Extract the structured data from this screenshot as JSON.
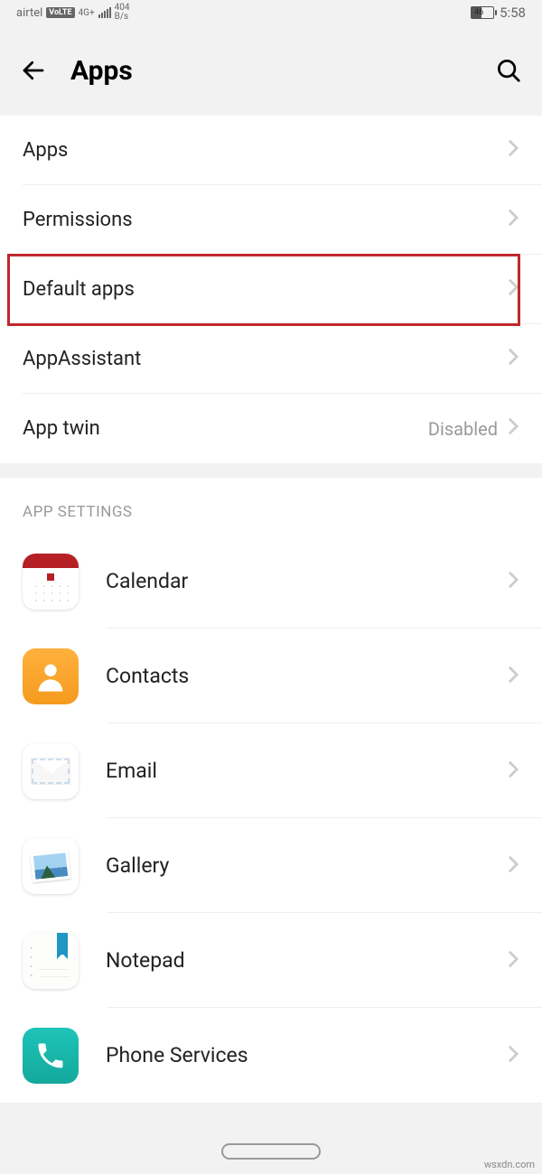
{
  "status": {
    "carrier": "airtel",
    "volte": "VoLTE",
    "network": "4G+",
    "speed_value": "404",
    "speed_unit": "B/s",
    "battery_pct": "46",
    "time": "5:58"
  },
  "header": {
    "title": "Apps"
  },
  "main_list": [
    {
      "label": "Apps",
      "value": ""
    },
    {
      "label": "Permissions",
      "value": ""
    },
    {
      "label": "Default apps",
      "value": ""
    },
    {
      "label": "AppAssistant",
      "value": ""
    },
    {
      "label": "App twin",
      "value": "Disabled"
    }
  ],
  "section_header": "APP SETTINGS",
  "apps": [
    {
      "label": "Calendar"
    },
    {
      "label": "Contacts"
    },
    {
      "label": "Email"
    },
    {
      "label": "Gallery"
    },
    {
      "label": "Notepad"
    },
    {
      "label": "Phone Services"
    }
  ],
  "watermark": "wsxdn.com"
}
